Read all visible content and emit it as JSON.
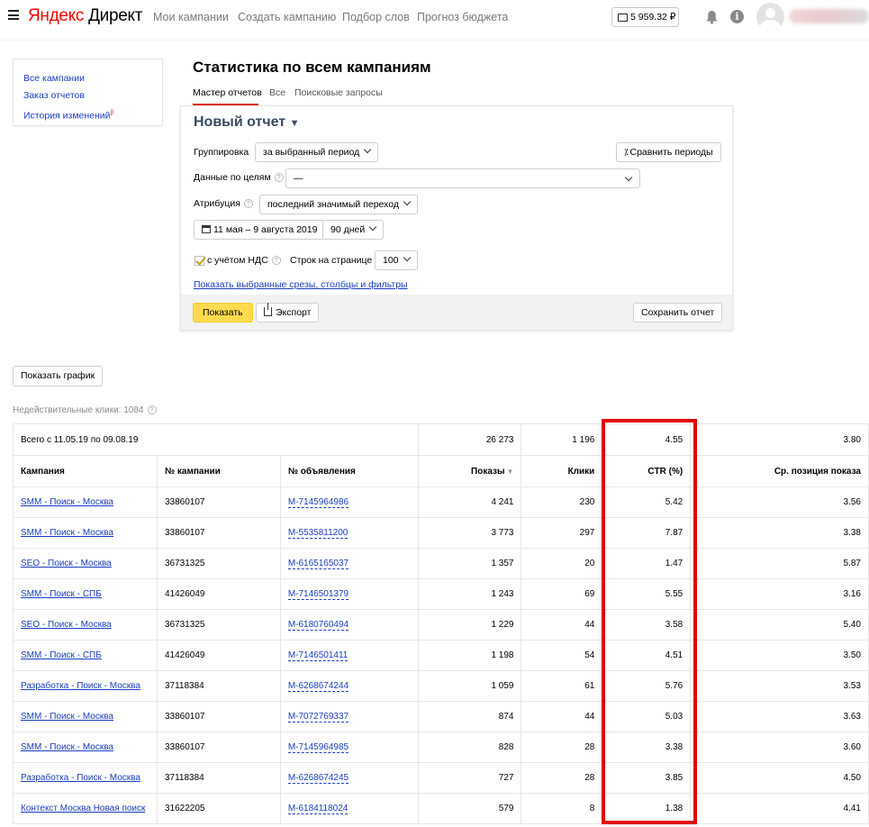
{
  "header": {
    "logo_brand": "Яндекс",
    "logo_product": "Директ",
    "nav": [
      "Мои кампании",
      "Создать кампанию",
      "Подбор слов",
      "Прогноз бюджета"
    ],
    "balance": "5 959.32 ₽"
  },
  "sidebar": {
    "items": [
      "Все кампании",
      "Заказ отчетов",
      "История изменений"
    ],
    "beta_mark": "β"
  },
  "page": {
    "title": "Статистика по всем кампаниям",
    "tabs": [
      "Мастер отчетов",
      "Все",
      "Поисковые запросы"
    ]
  },
  "report": {
    "title": "Новый отчет",
    "grouping_label": "Группировка",
    "grouping_value": "за выбранный период",
    "compare_button": "Сравнить периоды",
    "goals_label": "Данные по целям",
    "goals_value": "—",
    "attribution_label": "Атрибуция",
    "attribution_value": "последний значимый переход",
    "date_range": "11 мая – 9 августа 2019",
    "period": "90 дней",
    "vat_label": "с учётом НДС",
    "vat_checked": true,
    "rows_label": "Строк на странице",
    "rows_value": "100",
    "slices_link": "Показать выбранные срезы, столбцы и фильтры",
    "show_button": "Показать",
    "export_button": "Экспорт",
    "save_button": "Сохранить отчет"
  },
  "chart_button": "Показать график",
  "invalid_clicks": "Недействительные клики: 1084",
  "table": {
    "total": {
      "label": "Всего с 11.05.19 по 09.08.19",
      "impressions": "26 273",
      "clicks": "1 196",
      "ctr": "4.55",
      "avg_position": "3.80"
    },
    "columns": [
      "Кампания",
      "№ кампании",
      "№ объявления",
      "Показы",
      "Клики",
      "CTR (%)",
      "Ср. позиция показа"
    ],
    "rows": [
      {
        "campaign": "SMM - Поиск - Москва",
        "campaign_id": "33860107",
        "ad_id": "M-7145964986",
        "impressions": "4 241",
        "clicks": "230",
        "ctr": "5.42",
        "position": "3.56"
      },
      {
        "campaign": "SMM - Поиск - Москва",
        "campaign_id": "33860107",
        "ad_id": "M-5535811200",
        "impressions": "3 773",
        "clicks": "297",
        "ctr": "7.87",
        "position": "3.38"
      },
      {
        "campaign": "SEO - Поиск - Москва",
        "campaign_id": "36731325",
        "ad_id": "M-6165165037",
        "impressions": "1 357",
        "clicks": "20",
        "ctr": "1.47",
        "position": "5.87"
      },
      {
        "campaign": "SMM - Поиск - СПБ",
        "campaign_id": "41426049",
        "ad_id": "M-7146501379",
        "impressions": "1 243",
        "clicks": "69",
        "ctr": "5.55",
        "position": "3.16"
      },
      {
        "campaign": "SEO - Поиск - Москва",
        "campaign_id": "36731325",
        "ad_id": "M-6180760494",
        "impressions": "1 229",
        "clicks": "44",
        "ctr": "3.58",
        "position": "5.40"
      },
      {
        "campaign": "SMM - Поиск - СПБ",
        "campaign_id": "41426049",
        "ad_id": "M-7146501411",
        "impressions": "1 198",
        "clicks": "54",
        "ctr": "4.51",
        "position": "3.50"
      },
      {
        "campaign": "Разработка - Поиск - Москва",
        "campaign_id": "37118384",
        "ad_id": "M-6268674244",
        "impressions": "1 059",
        "clicks": "61",
        "ctr": "5.76",
        "position": "3.53"
      },
      {
        "campaign": "SMM - Поиск - Москва",
        "campaign_id": "33860107",
        "ad_id": "M-7072769337",
        "impressions": "874",
        "clicks": "44",
        "ctr": "5.03",
        "position": "3.63"
      },
      {
        "campaign": "SMM - Поиск - Москва",
        "campaign_id": "33860107",
        "ad_id": "M-7145964985",
        "impressions": "828",
        "clicks": "28",
        "ctr": "3.38",
        "position": "3.60"
      },
      {
        "campaign": "Разработка - Поиск - Москва",
        "campaign_id": "37118384",
        "ad_id": "M-6268674245",
        "impressions": "727",
        "clicks": "28",
        "ctr": "3.85",
        "position": "4.50"
      },
      {
        "campaign": "Контекст Москва Новая поиск",
        "campaign_id": "31622205",
        "ad_id": "M-6184118024",
        "impressions": "579",
        "clicks": "8",
        "ctr": "1.38",
        "position": "4.41"
      }
    ]
  },
  "colors": {
    "link": "#1a3dc1",
    "highlight_box": "#e30000",
    "primary_button": "#ffdb4d",
    "logo_accent": "#ff0000"
  }
}
